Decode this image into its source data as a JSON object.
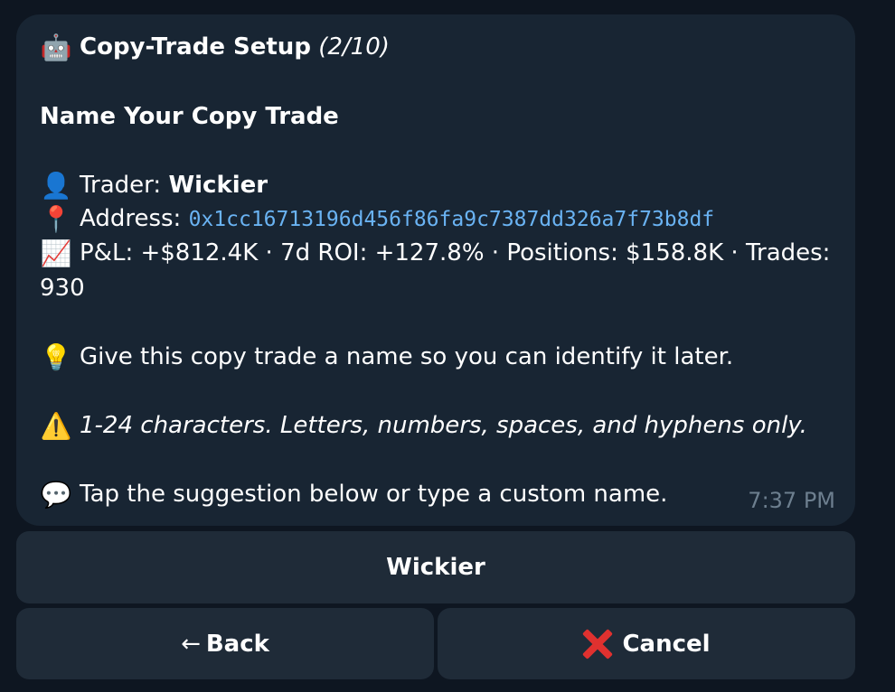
{
  "message": {
    "title_icon": "robot-icon",
    "title": "Copy-Trade Setup",
    "title_step": "(2/10)",
    "heading": "Name Your Copy Trade",
    "trader_icon": "user-silhouette-icon",
    "trader_label": "Trader:",
    "trader_name": "Wickier",
    "address_icon": "pushpin-icon",
    "address_label": "Address:",
    "address_value": "0x1cc16713196d456f86fa9c7387dd326a7f73b8df",
    "stats_icon": "chart-increasing-icon",
    "stats_line1": "P&L: +$812.4K · 7d ROI: +127.8% · Positions: $158.8K · Trades:",
    "stats_line2": "930",
    "tip_icon": "light-bulb-icon",
    "tip_text": "Give this copy trade a name so you can identify it later.",
    "warning_icon": "warning-icon",
    "warning_text": "1-24 characters. Letters, numbers, spaces, and hyphens only.",
    "hint_icon": "speech-bubble-icon",
    "hint_text": "Tap the suggestion below or type a custom name.",
    "time": "7:37 PM"
  },
  "buttons": {
    "suggestion_label": "Wickier",
    "back_arrow": "←",
    "back_label": "Back",
    "cancel_icon": "cross-mark-icon",
    "cancel_label": "Cancel"
  },
  "colors": {
    "background": "#0e1621",
    "bubble": "#182533",
    "button": "#1f2b38",
    "link": "#6ab3f3",
    "cancel_x": "#e0312f"
  }
}
